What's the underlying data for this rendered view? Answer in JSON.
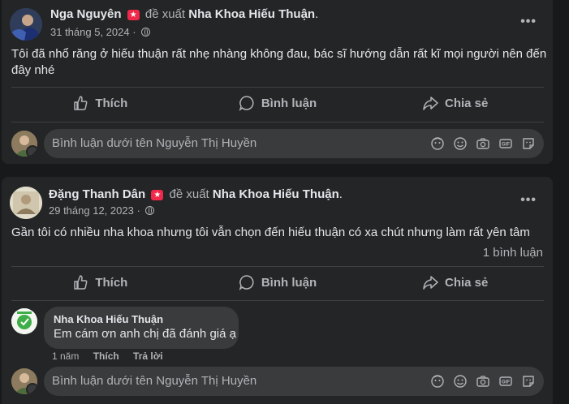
{
  "post1": {
    "author": "Nga Nguyên",
    "verb": "đề xuất",
    "page": "Nha Khoa Hiếu Thuận",
    "date": "31 tháng 5, 2024",
    "text": "Tôi đã nhổ răng ở hiếu thuận rất nhẹ nhàng không đau, bác sĩ hướng dẫn rất kĩ mọi người nên đến đây nhé",
    "comment_placeholder": "Bình luận dưới tên Nguyễn Thị Huyền"
  },
  "post2": {
    "author": "Đặng Thanh Dân",
    "verb": "đề xuất",
    "page": "Nha Khoa Hiếu Thuận",
    "date": "29 tháng 12, 2023",
    "text": "Gần tôi có nhiều nha khoa nhưng tôi vẫn chọn đến hiếu thuận có xa chút nhưng làm rất yên tâm",
    "comment_count": "1 bình luận",
    "reply": {
      "author": "Nha Khoa Hiếu Thuận",
      "text": "Em cám ơn anh chị đã đánh giá ạ",
      "time": "1 năm",
      "like": "Thích",
      "reply": "Trả lời"
    },
    "comment_placeholder": "Bình luận dưới tên Nguyễn Thị Huyền"
  },
  "actions": {
    "like": "Thích",
    "comment": "Bình luận",
    "share": "Chia sẻ"
  },
  "more_label": "•••",
  "dot": ".",
  "badge_icon": "recommend-star-icon",
  "colors": {
    "background": "#18191a",
    "card": "#242526",
    "input": "#3a3b3c",
    "text": "#e4e6eb",
    "muted": "#b0b3b8",
    "badge": "#f02849"
  }
}
